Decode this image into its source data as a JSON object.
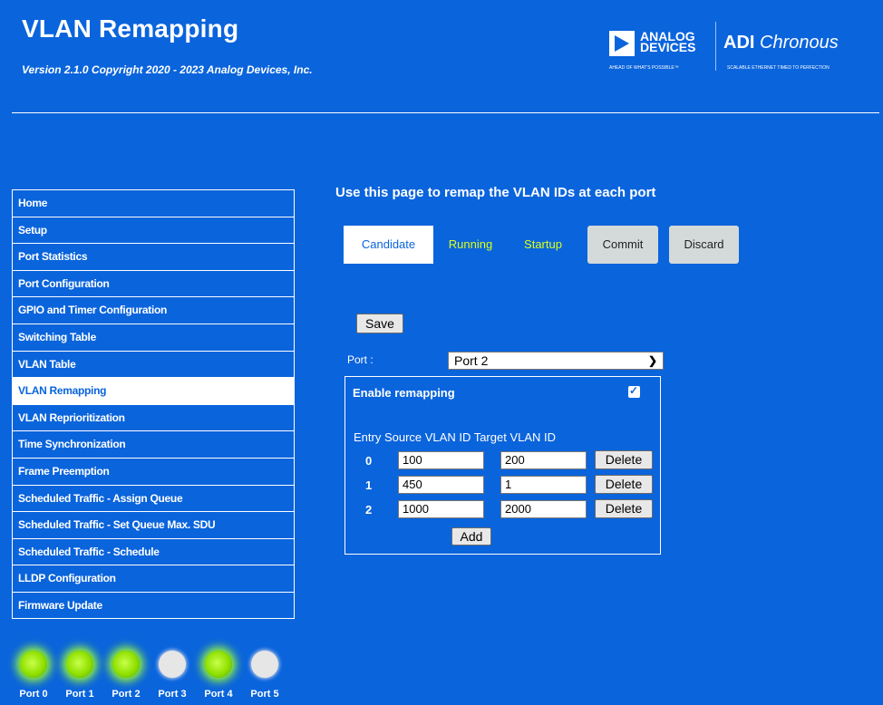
{
  "header": {
    "title": "VLAN Remapping",
    "version": "Version 2.1.0 Copyright 2020 - 2023 Analog Devices, Inc.",
    "logo_line1": "ANALOG",
    "logo_line2": "DEVICES",
    "logo_tagline": "AHEAD OF WHAT'S POSSIBLE™",
    "product_bold": "ADI",
    "product_italic": "Chronous",
    "product_tagline": "SCALABLE ETHERNET TIMED TO PERFECTION"
  },
  "sidebar": {
    "items": [
      {
        "label": "Home"
      },
      {
        "label": "Setup"
      },
      {
        "label": "Port Statistics"
      },
      {
        "label": "Port Configuration"
      },
      {
        "label": "GPIO and Timer Configuration"
      },
      {
        "label": "Switching Table"
      },
      {
        "label": "VLAN Table"
      },
      {
        "label": "VLAN Remapping",
        "active": true
      },
      {
        "label": "VLAN Reprioritization"
      },
      {
        "label": "Time Synchronization"
      },
      {
        "label": "Frame Preemption"
      },
      {
        "label": "Scheduled Traffic - Assign Queue"
      },
      {
        "label": "Scheduled Traffic - Set Queue Max. SDU"
      },
      {
        "label": "Scheduled Traffic - Schedule"
      },
      {
        "label": "LLDP Configuration"
      },
      {
        "label": "Firmware Update"
      }
    ]
  },
  "ports": [
    {
      "label": "Port 0",
      "status": "on"
    },
    {
      "label": "Port 1",
      "status": "on"
    },
    {
      "label": "Port 2",
      "status": "on"
    },
    {
      "label": "Port 3",
      "status": "off"
    },
    {
      "label": "Port 4",
      "status": "on"
    },
    {
      "label": "Port 5",
      "status": "off"
    }
  ],
  "main": {
    "heading": "Use this page to remap the VLAN IDs at each port",
    "tabs": {
      "candidate": "Candidate",
      "running": "Running",
      "startup": "Startup"
    },
    "commit_label": "Commit",
    "discard_label": "Discard",
    "save_label": "Save",
    "port_label": "Port :",
    "port_selected": "Port 2",
    "enable_label": "Enable remapping",
    "enable_checked": true,
    "table_header": "Entry Source VLAN ID Target VLAN ID",
    "rows": [
      {
        "entry": "0",
        "source": "100",
        "target": "200"
      },
      {
        "entry": "1",
        "source": "450",
        "target": "1"
      },
      {
        "entry": "2",
        "source": "1000",
        "target": "2000"
      }
    ],
    "delete_label": "Delete",
    "add_label": "Add"
  },
  "colors": {
    "background": "#0a64dc",
    "link_yellow": "#d8ff1a",
    "led_on": "#8fe000",
    "led_off": "#e6e6e6"
  }
}
